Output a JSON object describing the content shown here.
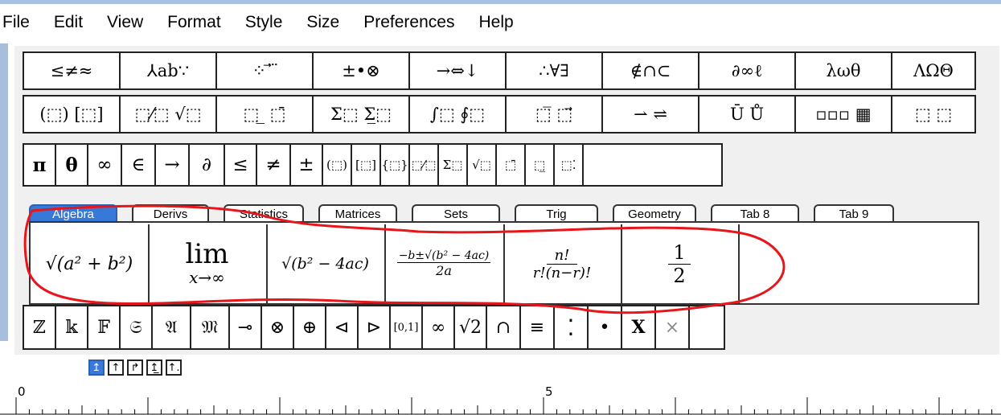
{
  "menu": [
    "File",
    "Edit",
    "View",
    "Format",
    "Style",
    "Size",
    "Preferences",
    "Help"
  ],
  "palette_row1": [
    "≤≠≈",
    "⅄ab∵",
    "⁘ ⃗ ⃛",
    "±•⊗",
    "→⇔↓",
    "∴∀∃",
    "∉∩⊂",
    "∂∞ℓ",
    "λωθ",
    "ΛΩΘ"
  ],
  "palette_row2": [
    "(⬚) [⬚]",
    "⬚⁄⬚ √⬚",
    "⬚ ̲ ⬚̄",
    "Σ⬚ Σ̲⬚",
    "∫⬚ ∮⬚",
    "⬚̅ ⬚⃗",
    "⇀ ⇌",
    "Ū Ů",
    "▫▫▫ ▦",
    "⬚ ⬚"
  ],
  "symbols_row": [
    "π",
    "θ",
    "∞",
    "∈",
    "→",
    "∂",
    "≤",
    "≠",
    "±",
    "(⬚)",
    "[⬚]",
    "{⬚}",
    "⬚⁄⬚",
    "Σ⬚",
    "√⬚",
    "⬚̄",
    "⬚̲",
    "⬚⁚",
    ""
  ],
  "tabs": [
    "Algebra",
    "Derivs",
    "Statistics",
    "Matrices",
    "Sets",
    "Trig",
    "Geometry",
    "Tab 8",
    "Tab 9"
  ],
  "active_tab": "Algebra",
  "algebra_templates": {
    "t1": "√(a² + b²)",
    "t2_top": "lim",
    "t2_bottom": "x→∞",
    "t3": "√(b² − 4ac)",
    "t4_num": "−b±√(b² − 4ac)",
    "t4_den": "2a",
    "t5_num": "n!",
    "t5_den": "r!(n−r)!",
    "t6_num": "1",
    "t6_den": "2"
  },
  "bottom_row": [
    "ℤ",
    "𝕜",
    "𝔽",
    "𝔖",
    "𝔄",
    "𝔐",
    "⊸",
    "⊗",
    "⊕",
    "⊲",
    "⊳",
    "[0,1]",
    "∞",
    "√2",
    "∩",
    "≡",
    "⁚",
    "•",
    "X",
    "×",
    ""
  ],
  "nudge_buttons": [
    "↥",
    "↑",
    "↱",
    "↥̲",
    "↑."
  ],
  "ruler_labels": [
    "0",
    "5"
  ],
  "colors": {
    "accent": "#3779d8",
    "annotation": "#e8151b",
    "frame": "#a7bfdd"
  }
}
